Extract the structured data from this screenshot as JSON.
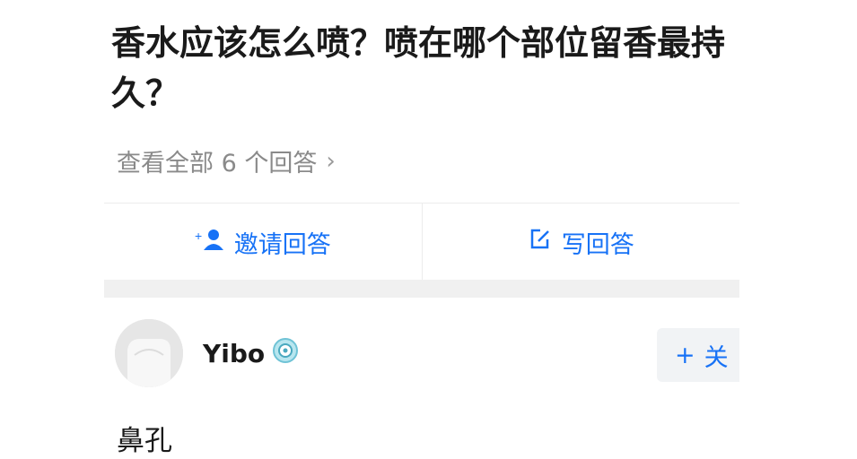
{
  "question": {
    "title": "香水应该怎么喷？喷在哪个部位留香最持久？",
    "view_all": "查看全部 6 个回答",
    "chevron_glyph": "›"
  },
  "actions": {
    "invite": {
      "label": "邀请回答",
      "icon": "add-person-icon"
    },
    "write": {
      "label": "写回答",
      "icon": "edit-icon"
    }
  },
  "answer": {
    "author": "Yibo",
    "badge_icon": "verified-badge-icon",
    "follow_label": "关",
    "follow_plus": "+",
    "text": "鼻孔"
  },
  "colors": {
    "accent": "#1772f6",
    "muted": "#8a8a8a",
    "divider": "#f0f0f0"
  }
}
